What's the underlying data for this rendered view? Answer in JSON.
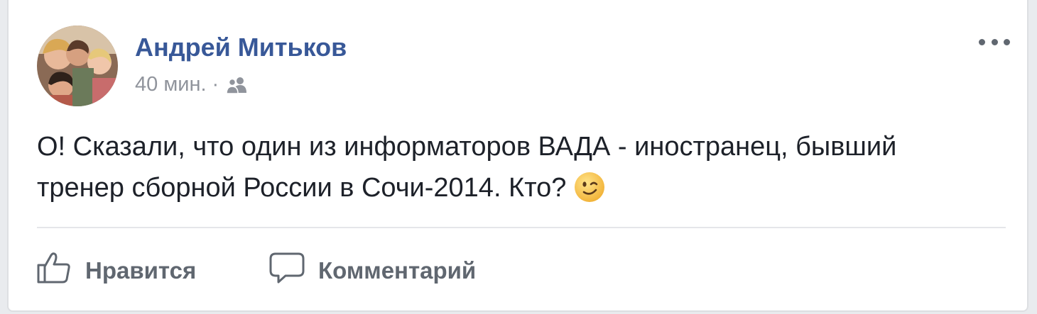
{
  "post": {
    "author": "Андрей Митьков",
    "time": "40 мин.",
    "separator": "·",
    "audience_icon": "friends-icon",
    "more_icon": "more-options-icon",
    "text_lines": [
      "О! Сказали, что один из информаторов ВАДА - иностранец, бывший",
      "тренер сборной России в Сочи-2014. Кто?"
    ],
    "emoji": "winking-face-icon"
  },
  "actions": {
    "like_label": "Нравится",
    "comment_label": "Комментарий"
  },
  "colors": {
    "author": "#385898",
    "meta": "#90949c",
    "text": "#1d2129",
    "action": "#606770",
    "background": "#e9ebee"
  }
}
